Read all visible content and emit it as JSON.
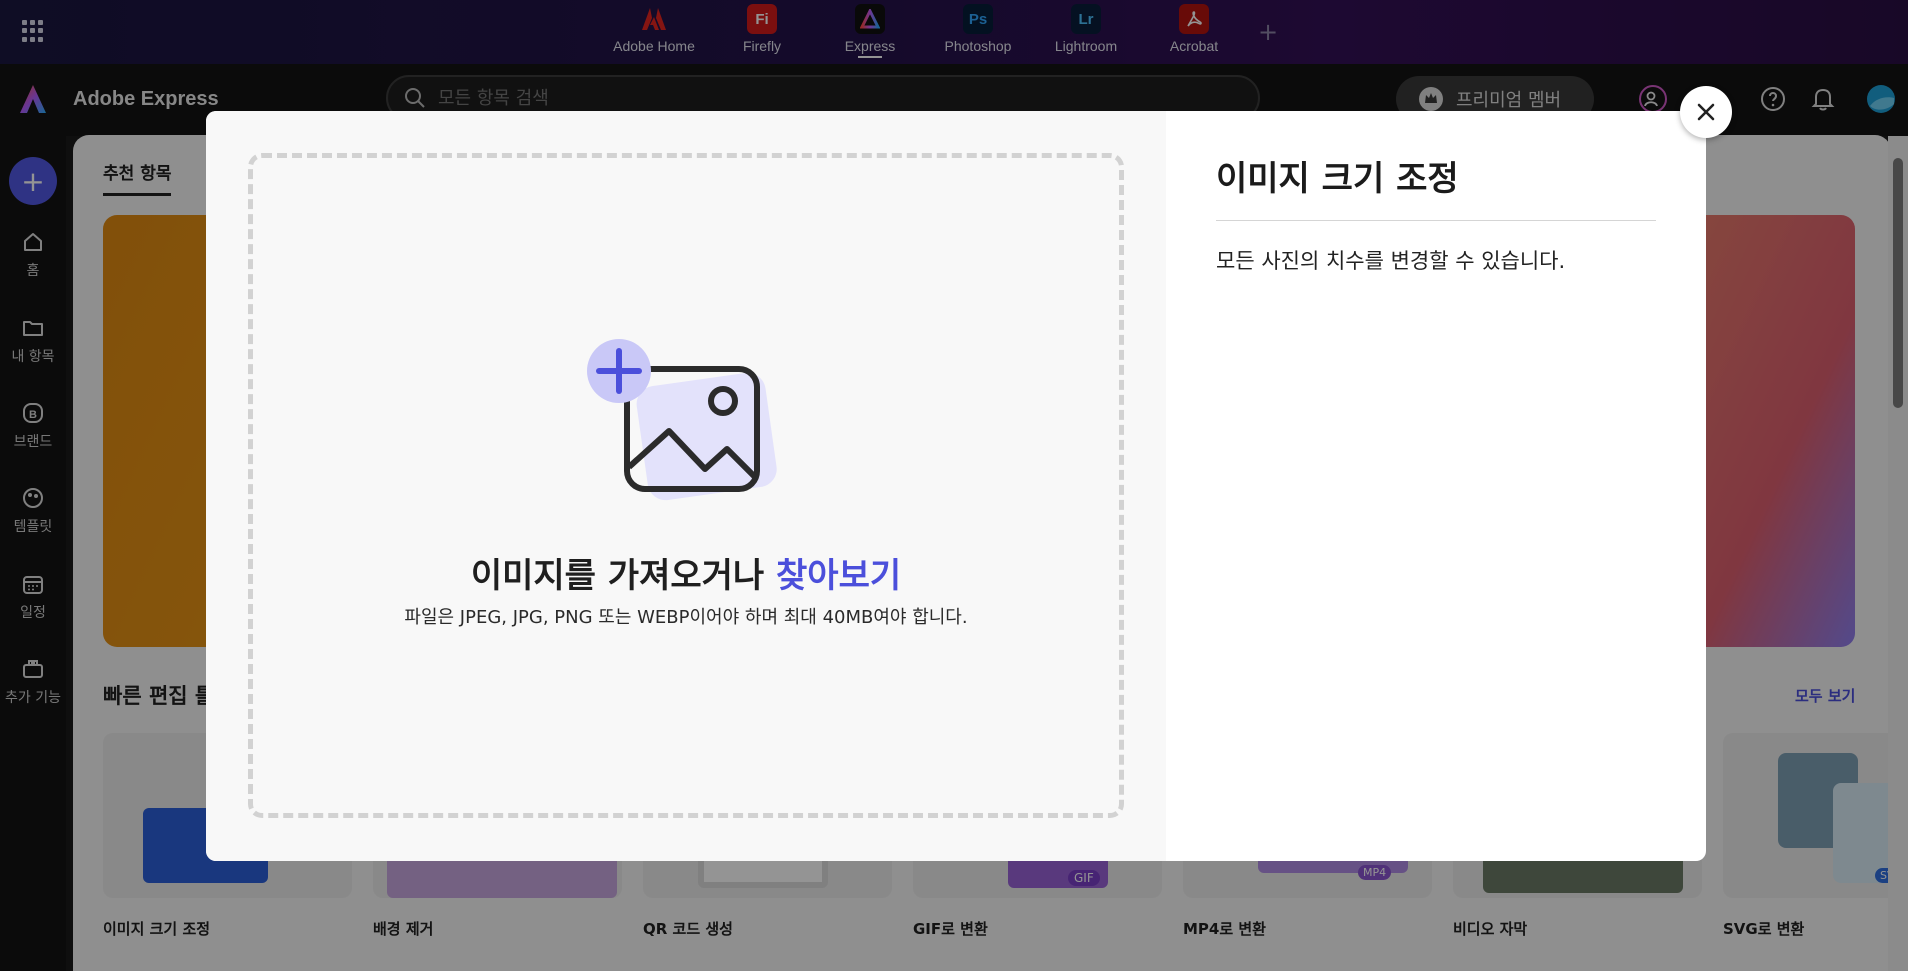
{
  "appbar": {
    "apps": [
      {
        "label": "Adobe Home",
        "abbr": "",
        "color": "#e5251f"
      },
      {
        "label": "Firefly",
        "abbr": "Fi",
        "color": "#d41a1a"
      },
      {
        "label": "Express",
        "abbr": "",
        "color": "#1a1a1a"
      },
      {
        "label": "Photoshop",
        "abbr": "Ps",
        "color": "#061e3a"
      },
      {
        "label": "Lightroom",
        "abbr": "Lr",
        "color": "#0a1e3c"
      },
      {
        "label": "Acrobat",
        "abbr": "",
        "color": "#b3130f"
      }
    ],
    "active_app": "Express"
  },
  "header": {
    "brand_name": "Adobe Express",
    "search_placeholder": "모든 항목 검색",
    "premium_label": "프리미엄 멤버"
  },
  "sidebar": {
    "items": [
      {
        "label": "홈",
        "icon": "home-icon"
      },
      {
        "label": "내 항목",
        "icon": "folder-icon"
      },
      {
        "label": "브랜드",
        "icon": "brand-icon"
      },
      {
        "label": "템플릿",
        "icon": "template-icon"
      },
      {
        "label": "일정",
        "icon": "calendar-icon"
      },
      {
        "label": "추가 기능",
        "icon": "addons-icon"
      }
    ]
  },
  "main": {
    "tab_label": "추천 항목",
    "quick_title": "빠른 편집 틀",
    "see_all": "모두 보기",
    "quick_actions": [
      "이미지 크기 조정",
      "배경 제거",
      "QR 코드 생성",
      "GIF로 변환",
      "MP4로 변환",
      "비디오 자막",
      "SVG로 변환"
    ],
    "badges": {
      "gif": "GIF",
      "mp4": "MP4",
      "svg": "SV"
    }
  },
  "modal": {
    "drop_title": "이미지를 가져오거나",
    "browse_label": "찾아보기",
    "drop_subtitle": "파일은 JPEG, JPG, PNG 또는 WEBP이어야 하며 최대 40MB여야 합니다.",
    "title": "이미지 크기 조정",
    "description": "모든 사진의 치수를 변경할 수 있습니다."
  },
  "colors": {
    "accent": "#4b4fdb",
    "create": "#5258e4"
  }
}
